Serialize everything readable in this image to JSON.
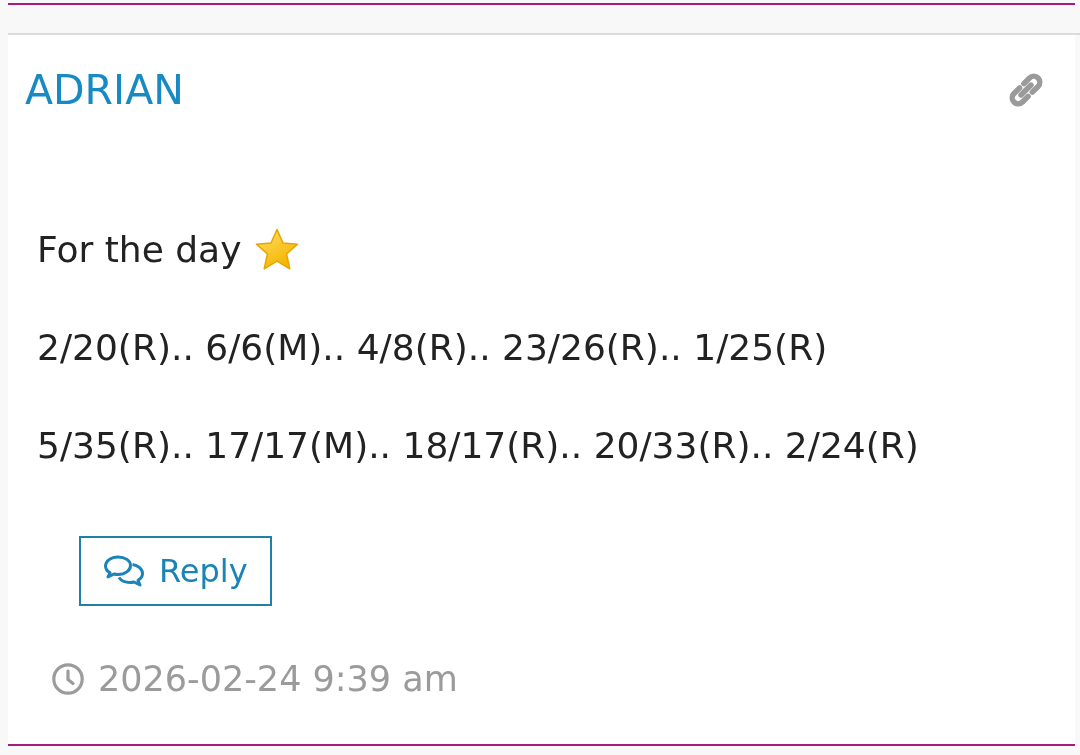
{
  "post": {
    "author": "ADRIAN",
    "paragraphs": [
      {
        "kind": "starred",
        "text": "For the day"
      },
      {
        "kind": "plain",
        "text": "2/20(R).. 6/6(M).. 4/8(R).. 23/26(R).. 1/25(R)"
      },
      {
        "kind": "plain",
        "text": "5/35(R).. 17/17(M).. 18/17(R).. 20/33(R).. 2/24(R)"
      }
    ],
    "reply_button": "Reply",
    "timestamp": "2026-02-24 9:39 am"
  }
}
